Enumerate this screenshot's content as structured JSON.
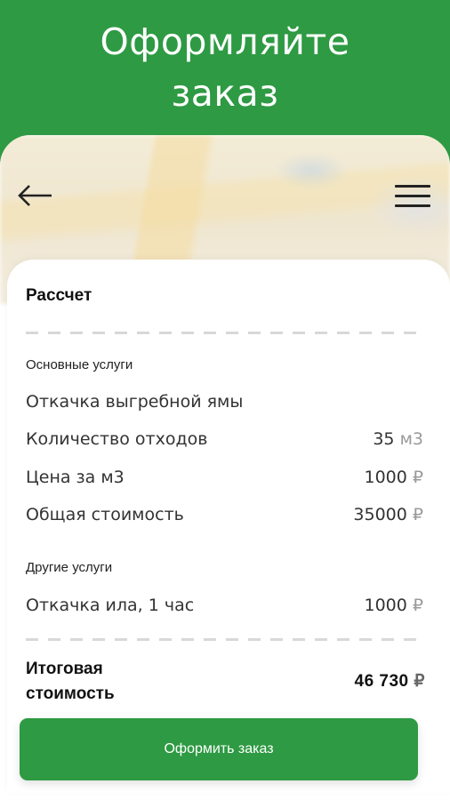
{
  "hero": {
    "title_line1": "Оформляйте",
    "title_line2": "заказ"
  },
  "header": {
    "back_icon": "arrow-left-icon",
    "menu_icon": "hamburger-menu-icon"
  },
  "calc": {
    "title": "Рассчет",
    "main_services": {
      "label": "Основные услуги",
      "service_name": "Откачка выгребной ямы",
      "rows": [
        {
          "label": "Количество отходов",
          "value": "35",
          "unit": "м3"
        },
        {
          "label": "Цена за м3",
          "value": "1000",
          "unit": "₽"
        },
        {
          "label": "Общая стоимость",
          "value": "35000",
          "unit": "₽"
        }
      ]
    },
    "other_services": {
      "label": "Другие услуги",
      "rows": [
        {
          "label": "Откачка ила, 1 час",
          "value": "1000",
          "unit": "₽"
        }
      ]
    },
    "total": {
      "label": "Итоговая стоимость",
      "value": "46 730",
      "currency": "₽"
    }
  },
  "order_button": {
    "label": "Оформить заказ"
  },
  "colors": {
    "brand_green": "#2e9a43"
  }
}
